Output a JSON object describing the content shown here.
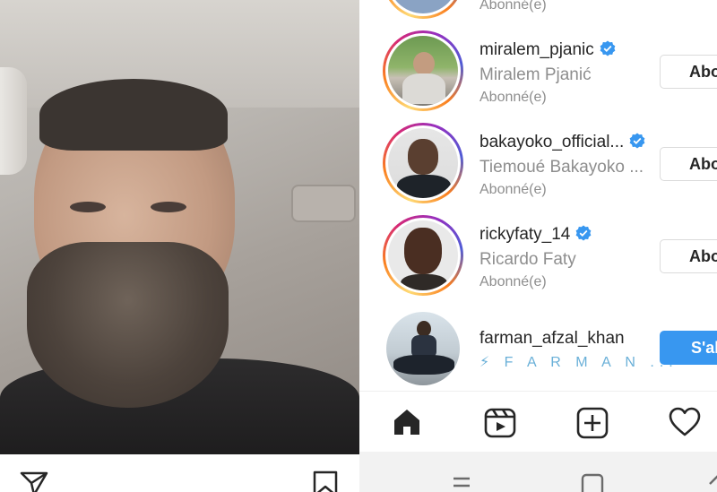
{
  "suggestions": [
    {
      "username": "miralem_pjanic",
      "verified": true,
      "full_name": "Miralem Pjanić",
      "status": "Abonné(e)",
      "button": "Abonné(e)"
    },
    {
      "username": "bakayoko_official...",
      "verified": true,
      "full_name": "Tiemoué Bakayoko ...",
      "status": "Abonné(e)",
      "button": "Abonné(e)"
    },
    {
      "username": "rickyfaty_14",
      "verified": true,
      "full_name": "Ricardo Faty",
      "status": "Abonné(e)",
      "button": "Abonné(e)"
    },
    {
      "username": "farman_afzal_khan",
      "verified": false,
      "full_name": "⚡ F A R M A N ...",
      "status": "",
      "button": "S'abonner"
    }
  ],
  "top_partial_status": "Abonné(e)",
  "icons": {
    "left_bar": [
      "send-icon",
      "bookmark-icon"
    ],
    "bottom_nav": [
      "home-icon",
      "reels-icon",
      "new-post-icon",
      "heart-icon"
    ]
  },
  "colors": {
    "accent": "#3897f0",
    "verified": "#3897f0",
    "text": "#262626",
    "muted": "#8e8e8e"
  }
}
